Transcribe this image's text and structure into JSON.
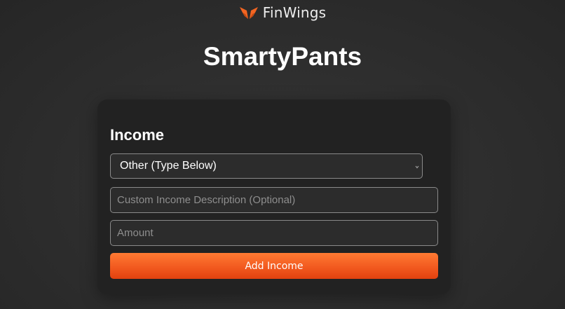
{
  "brand": {
    "name": "FinWings",
    "logo_icon": "wings-icon",
    "logo_color": "#f26522"
  },
  "app": {
    "title": "SmartyPants"
  },
  "income_form": {
    "section_title": "Income",
    "category_select": {
      "selected": "Other (Type Below)",
      "icon": "chevron-down-icon"
    },
    "description_input": {
      "value": "",
      "placeholder": "Custom Income Description (Optional)"
    },
    "amount_input": {
      "value": "",
      "placeholder": "Amount"
    },
    "submit_label": "Add Income"
  },
  "colors": {
    "background": "#2d2d2d",
    "card": "#222222",
    "accent": "#f25a1f",
    "text": "#ffffff",
    "placeholder": "#8e8e8e"
  }
}
